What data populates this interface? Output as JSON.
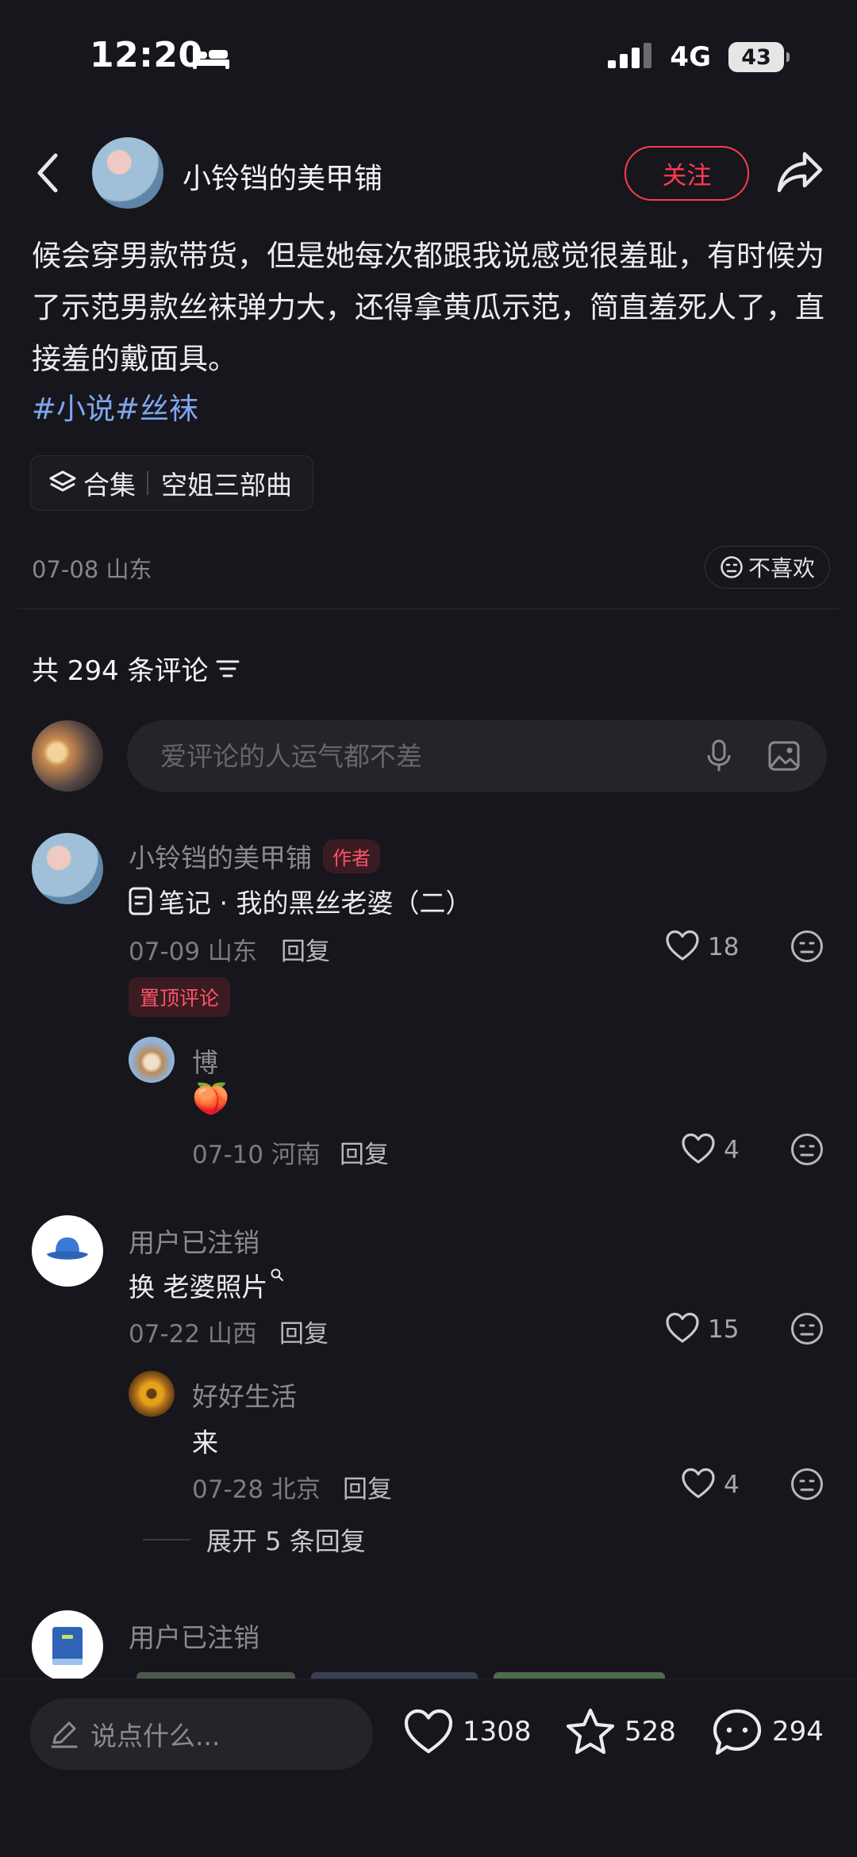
{
  "status_bar": {
    "time": "12:20",
    "network": "4G",
    "battery": "43"
  },
  "header": {
    "author": "小铃铛的美甲铺",
    "follow_label": "关注"
  },
  "post": {
    "body": "候会穿男款带货，但是她每次都跟我说感觉很羞耻，有时候为了示范男款丝袜弹力大，还得拿黄瓜示范，简直羞死人了，直接羞的戴面具。",
    "hashtags": "#小说#丝袜",
    "collection_label": "合集",
    "collection_name": "空姐三部曲",
    "meta": "07-08 山东",
    "dislike_label": "不喜欢"
  },
  "comments_header": {
    "count_text": "共 294 条评论"
  },
  "comment_input": {
    "placeholder": "爱评论的人运气都不差"
  },
  "comments": [
    {
      "name": "小铃铛的美甲铺",
      "tag": "作者",
      "text": "笔记 · 我的黑丝老婆（二）",
      "date": "07-09 山东",
      "reply": "回复",
      "likes": "18",
      "pinned": "置顶评论",
      "replies": [
        {
          "name": "博",
          "text": "🍑",
          "date": "07-10 河南",
          "reply": "回复",
          "likes": "4"
        }
      ]
    },
    {
      "name": "用户已注销",
      "text": "换 老婆照片",
      "date": "07-22 山西",
      "reply": "回复",
      "likes": "15",
      "replies": [
        {
          "name": "好好生活",
          "text": "来",
          "date": "07-28 北京",
          "reply": "回复",
          "likes": "4"
        }
      ],
      "expand": "展开 5 条回复"
    },
    {
      "name": "用户已注销"
    }
  ],
  "bottom_bar": {
    "input_placeholder": "说点什么...",
    "likes": "1308",
    "stars": "528",
    "comments": "294"
  },
  "colors": {
    "accent": "#ff3b4e",
    "hashtag": "#7fa6ee",
    "background": "#16161c"
  }
}
